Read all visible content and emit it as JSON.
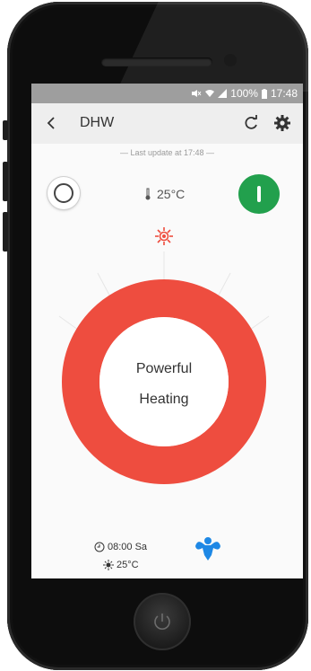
{
  "status_bar": {
    "battery": "100%",
    "time": "17:48"
  },
  "app_bar": {
    "title": "DHW",
    "back_icon": "chevron-left-icon",
    "refresh_icon": "refresh-icon",
    "settings_icon": "gear-icon"
  },
  "content": {
    "last_update": "— Last update at 17:48 —",
    "temperature": "25°C",
    "mode_label_line1": "Powerful",
    "mode_label_line2": "Heating",
    "dial_color": "#ee4d3f",
    "power_color": "#22a04d",
    "schedule_time": "08:00 Sa",
    "schedule_temp": "25°C"
  }
}
